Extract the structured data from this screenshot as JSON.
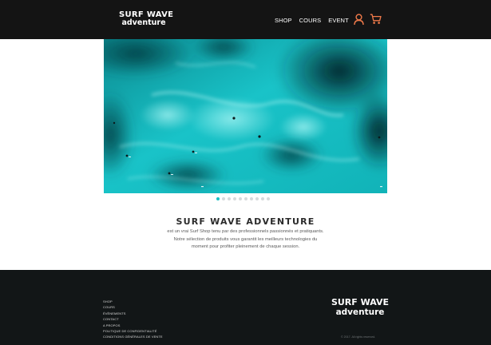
{
  "header": {
    "logo": {
      "line1": "SURF WAVE",
      "line2": "adventure"
    },
    "nav": [
      {
        "label": "SHOP"
      },
      {
        "label": "COURS"
      },
      {
        "label": "EVENT"
      }
    ],
    "icons": {
      "user": "user-icon",
      "cart": "cart-icon"
    },
    "accent_color": "#f07a4a"
  },
  "hero": {
    "image": "aerial-surf-ocean",
    "slide_count": 10,
    "active_slide": 1
  },
  "intro": {
    "title": "SURF WAVE ADVENTURE",
    "lines": [
      "est un vrai Surf Shop tenu par des professionnels passionnés et pratiquants.",
      "Notre sélection de produits vous garantit les meilleurs technologies du",
      "moment pour profiter pleinement de chaque session."
    ]
  },
  "footer": {
    "links": [
      {
        "label": "SHOP"
      },
      {
        "label": "COURS"
      },
      {
        "label": "ÉVÈNEMENTS"
      },
      {
        "label": "CONTACT"
      },
      {
        "label": "A PROPOS"
      },
      {
        "label": "POLITIQUE DE CONFIDENTIALITÉ"
      },
      {
        "label": "CONDITIONS GÉNÉRALES DE VENTE"
      }
    ],
    "logo": {
      "line1": "SURF WAVE",
      "line2": "adventure"
    },
    "copyright": "© 2017. All rights reserved."
  }
}
